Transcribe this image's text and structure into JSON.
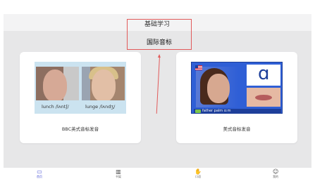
{
  "header": {
    "tab_basic": "基础学习",
    "tab_ipa": "国际音标"
  },
  "cards": [
    {
      "title": "BBC英式音标发音",
      "captions": [
        "lunch /lʌntʃ/",
        "lunge /lʌndʒ/"
      ]
    },
    {
      "title": "美式音标发音",
      "letter": "ɑ",
      "strip_text": "father  palm  ɑ:m"
    }
  ],
  "bottom_nav": [
    {
      "icon": "book-open-icon",
      "glyph": "▭",
      "label": "首页"
    },
    {
      "icon": "book-icon",
      "glyph": "▥",
      "label": "书架"
    },
    {
      "icon": "hand-icon",
      "glyph": "✋",
      "label": "口语"
    },
    {
      "icon": "user-icon",
      "glyph": "☺",
      "label": "我的"
    }
  ],
  "colors": {
    "accent": "#4b55d6",
    "highlight": "#e15a5a",
    "background": "#e7e7e8"
  }
}
